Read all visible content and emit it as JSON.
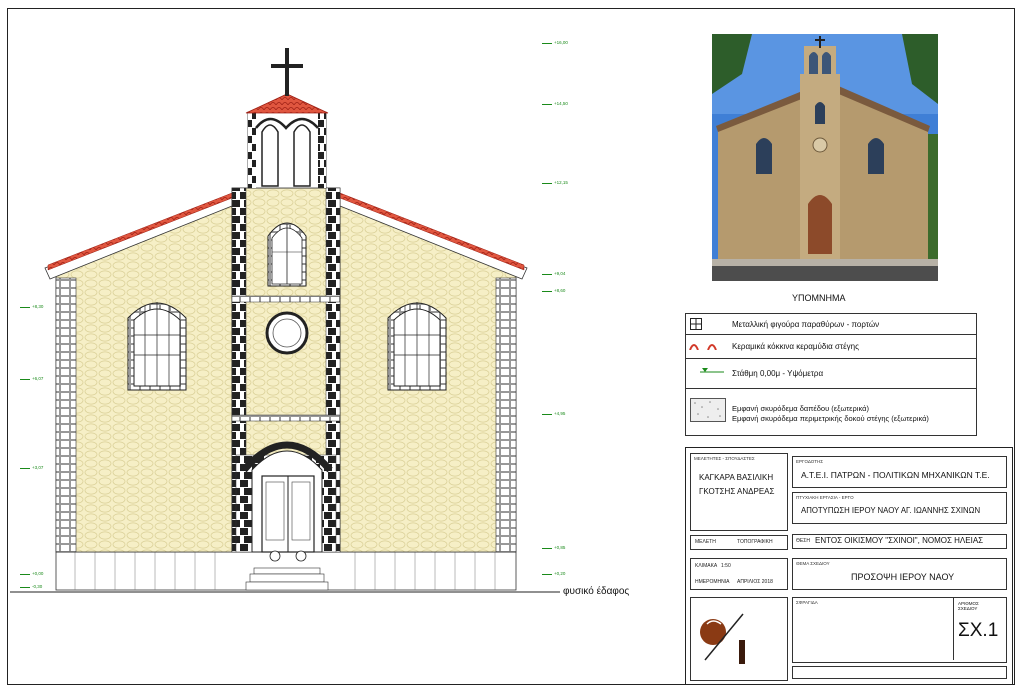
{
  "ground_label": "φυσικό έδαφος",
  "levels": [
    "+16,00",
    "+14,50",
    "+12,15",
    "+9,04",
    "+8,60",
    "+8,30",
    "+6,07",
    "+4,95",
    "+3,07",
    "+0,85",
    "+0,00",
    "+0,20",
    "-0,30"
  ],
  "legend": {
    "title": "ΥΠΟΜΝΗΜΑ",
    "items": [
      {
        "text": "Μεταλλική φιγούρα παραθύρων - πορτών",
        "icon": "window-grille-icon"
      },
      {
        "text": "Κεραμικά κόκκινα κεραμύδια στέγης",
        "icon": "roof-tile-icon"
      },
      {
        "text": "Στάθμη 0,00μ - Υψόμετρα",
        "icon": "level-marker-icon"
      },
      {
        "text": "Εμφανή σκυρόδεμα δαπέδου (εξωτερικά)",
        "text2": "Εμφανή σκυρόδεμα περιμετρικής δοκού στέγης (εξωτερικά)",
        "icon": "concrete-hatch-icon"
      }
    ]
  },
  "titleblock": {
    "designers_header": "ΜΕΛΕΤΗΤΕΣ - ΣΠΟΥΔΑΣΤΕΣ",
    "designer1": "ΚΑΓΚΑΡΑ ΒΑΣΙΛΙΚΗ",
    "designer2": "ΓΚΟΤΣΗΣ ΑΝΔΡΕΑΣ",
    "client_header": "ΕΡΓΟΔΟΤΗΣ",
    "client": "Α.Τ.Ε.Ι. ΠΑΤΡΩΝ - ΠΟΛΙΤΙΚΩΝ ΜΗΧΑΝΙΚΩΝ Τ.Ε.",
    "project_header": "ΠΤΥΧΙΑΚΗ ΕΡΓΑΣΙΑ - ΕΡΓΟ",
    "project": "ΑΠΟΤΥΠΩΣΗ ΙΕΡΟΥ ΝΑΟΥ ΑΓ. ΙΩΑΝΝΗΣ ΣΧΙΝΩΝ",
    "study_label": "ΜΕΛΕΤΗ",
    "study_value": "ΤΟΠΟΓΡΑΦΙΚΗ",
    "location_label": "ΘΕΣΗ",
    "location": "ΕΝΤΟΣ ΟΙΚΙΣΜΟΥ \"ΣΧΙΝΟΙ\", ΝΟΜΟΣ ΗΛΕΙΑΣ",
    "scale_label": "ΚΛΙΜΑΚΑ",
    "scale_value": "1:50",
    "date_label": "ΗΜΕΡΟΜΗΝΙΑ",
    "date_value": "ΑΠΡΙΛΙΟΣ 2018",
    "theme_header": "ΘΕΜΑ ΣΧΕΔΙΟΥ",
    "theme": "ΠΡΟΣΟΨΗ ΙΕΡΟΥ ΝΑΟΥ",
    "stamp_label": "ΣΦΡΑΓΙΔΑ",
    "drawing_no_label": "ΑΡΙΘΜΟΣ ΣΧΕΔΙΟΥ",
    "drawing_no": "ΣΧ.1"
  },
  "colors": {
    "stone_fill": "#f6efc6",
    "roof_red": "#d23a2a",
    "level_green": "#1a8a1a",
    "sky": "#3f7fd6"
  }
}
